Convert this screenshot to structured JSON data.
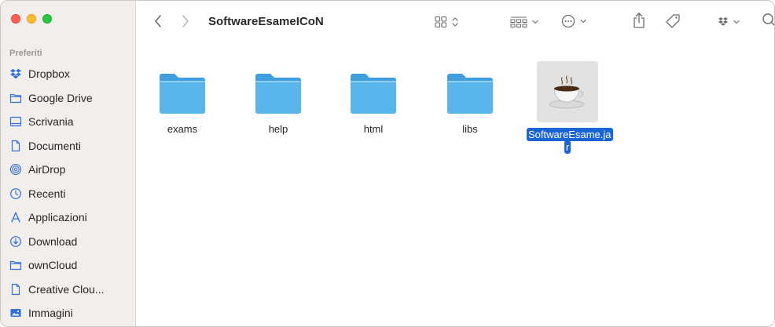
{
  "window": {
    "title": "SoftwareEsameICoN"
  },
  "sidebar": {
    "section_title": "Preferiti",
    "items": [
      {
        "label": "Dropbox",
        "icon": "dropbox-icon"
      },
      {
        "label": "Google Drive",
        "icon": "folder-icon"
      },
      {
        "label": "Scrivania",
        "icon": "desktop-icon"
      },
      {
        "label": "Documenti",
        "icon": "document-icon"
      },
      {
        "label": "AirDrop",
        "icon": "airdrop-icon"
      },
      {
        "label": "Recenti",
        "icon": "clock-icon"
      },
      {
        "label": "Applicazioni",
        "icon": "applications-icon"
      },
      {
        "label": "Download",
        "icon": "download-icon"
      },
      {
        "label": "ownCloud",
        "icon": "folder-icon"
      },
      {
        "label": "Creative Clou...",
        "icon": "document-icon"
      },
      {
        "label": "Immagini",
        "icon": "photos-icon"
      }
    ]
  },
  "files": [
    {
      "name": "exams",
      "type": "folder"
    },
    {
      "name": "help",
      "type": "folder"
    },
    {
      "name": "html",
      "type": "folder"
    },
    {
      "name": "libs",
      "type": "folder"
    },
    {
      "name_line1": "SoftwareEsame.ja",
      "name_line2": "r",
      "type": "jar",
      "selected": true
    }
  ],
  "colors": {
    "accent": "#1a64d6",
    "folder": "#5ab5ea",
    "sidebar_bg": "#f2eeec"
  }
}
